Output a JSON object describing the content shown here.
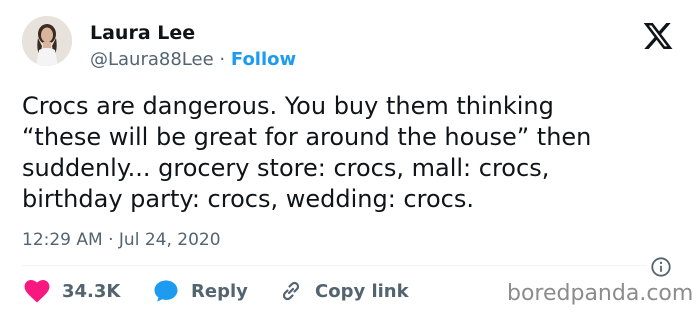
{
  "author": {
    "name": "Laura Lee",
    "handle": "@Laura88Lee",
    "separator": "·",
    "follow_label": "Follow"
  },
  "tweet": {
    "text": "Crocs are dangerous. You buy them thinking\n“these will be great for around the house” then\nsuddenly... grocery store: crocs, mall: crocs,\nbirthday party: crocs, wedding: crocs.",
    "timestamp": "12:29 AM · Jul 24, 2020"
  },
  "actions": {
    "likes_count": "34.3K",
    "reply_label": "Reply",
    "copy_link_label": "Copy link"
  },
  "icons": {
    "logo": "x-logo-icon",
    "info": "info-icon",
    "like": "heart-icon",
    "reply": "reply-bubble-icon",
    "copy": "link-icon"
  },
  "colors": {
    "text": "#0f1419",
    "secondary": "#536471",
    "accent": "#1d9bf0",
    "like": "#f91880",
    "watermark": "#8c8c8c"
  },
  "watermark": "boredpanda.com"
}
